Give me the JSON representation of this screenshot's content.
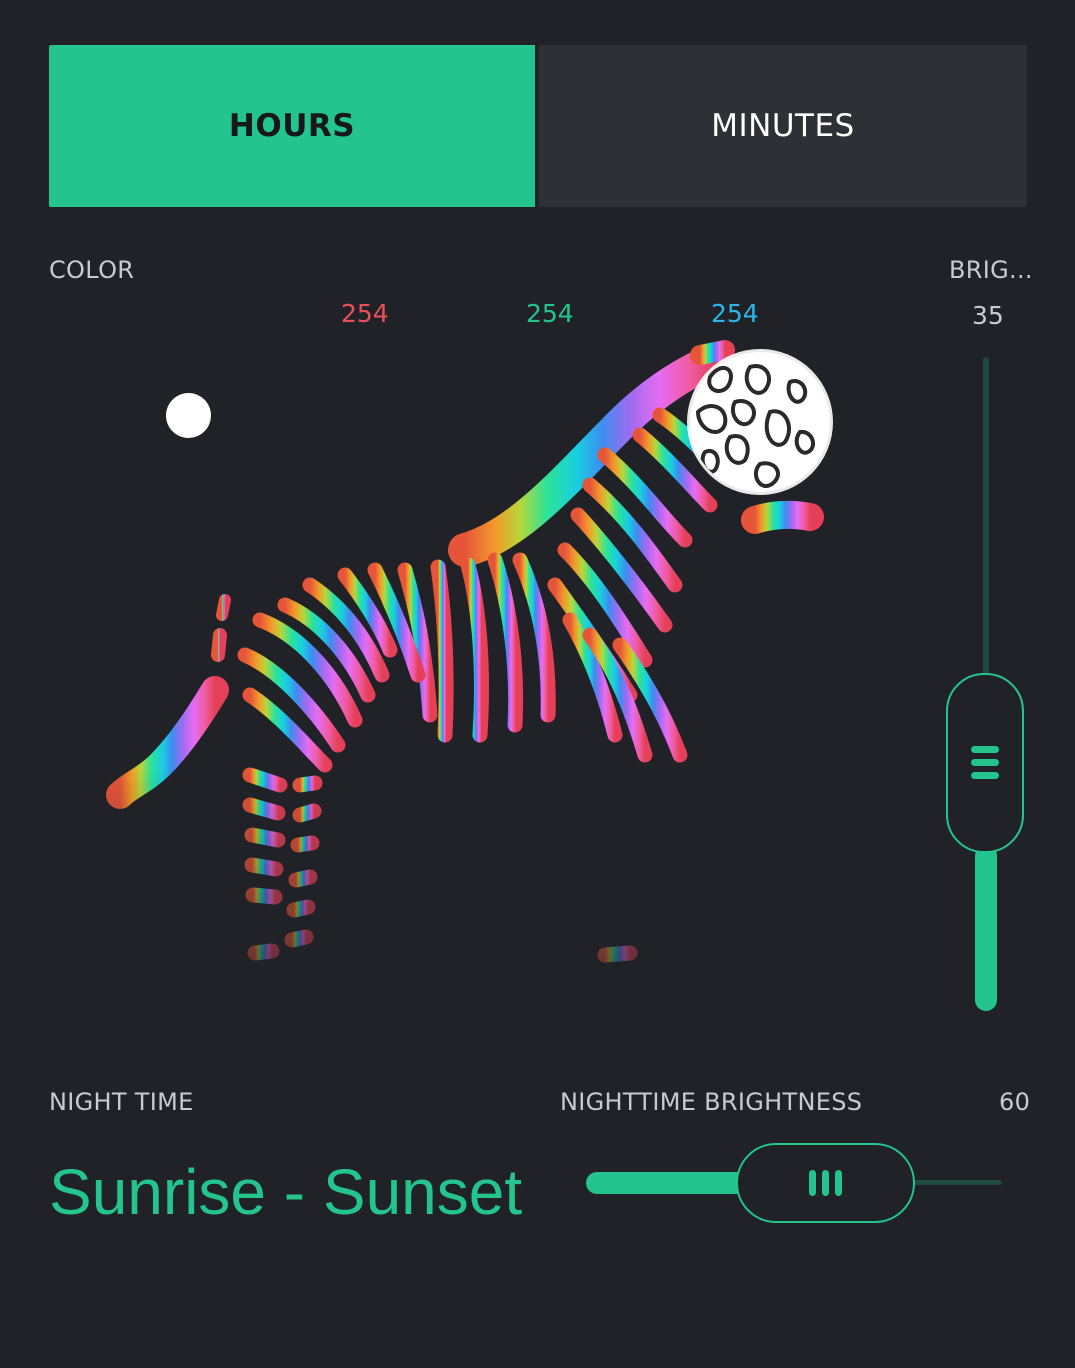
{
  "tabs": {
    "hours_label": "HOURS",
    "minutes_label": "MINUTES",
    "active": "HOURS"
  },
  "color_section": {
    "label": "COLOR",
    "red": "254",
    "green": "254",
    "blue": "254",
    "red_color": "#E8505B",
    "green_color": "#23C48E",
    "blue_color": "#2DB5E8",
    "picker_image": "rainbow-zebra"
  },
  "brightness": {
    "label": "BRIG...",
    "value": "35"
  },
  "night_time": {
    "label": "NIGHT TIME",
    "value": "Sunrise - Sunset"
  },
  "nighttime_brightness": {
    "label": "NIGHTTIME BRIGHTNESS",
    "value": "60"
  },
  "colors": {
    "accent": "#23C48E",
    "background": "#212227",
    "inactive_tab": "#2F3035"
  },
  "icons": {
    "vertical_grip": "grip-horizontal-lines-icon",
    "horizontal_grip": "grip-vertical-lines-icon"
  }
}
